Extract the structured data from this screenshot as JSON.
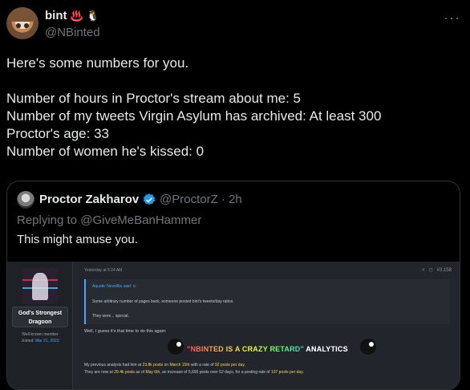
{
  "author": {
    "display_name": "bint",
    "emoji_1": "♨️",
    "emoji_2": "🐧",
    "handle": "@NBinted",
    "more_icon": "ellipsis-icon"
  },
  "tweet": {
    "lines": [
      "Here's some numbers for you.",
      "",
      "Number of hours in Proctor's stream about me: 5",
      "Number of my tweets Virgin Asylum has archived: At least 300",
      "Proctor's age: 33",
      "Number of women he's kissed: 0"
    ]
  },
  "quoted": {
    "display_name": "Proctor Zakharov",
    "handle_time": "@ProctorZ · 2h",
    "verified_color": "#1d9bf0",
    "replying_prefix": "Replying to",
    "replying_to": "@GiveMeBanHammer",
    "text": "This might amuse you.",
    "forum": {
      "username": "God's Strongest Dragoon",
      "member_title": "Well-known member",
      "joined_label": "Joined:",
      "joined_date": "Mar 21, 2023",
      "time": "Yesterday at 5:24 AM",
      "post_number": "#3,158",
      "quote_author": "Aquatic Novellite said: ⊙",
      "quote_p1": "Some arbitrary number of pages back, someone posted bint's tweets/day ratios.",
      "quote_p2": "They were... special.",
      "line1": "Well, I guess it's that time to do this again:",
      "banner_main": "\"NBINTED IS A CRAZY RETARD\"",
      "banner_rest": " ANALYTICS",
      "line2_a": "My previous analysis had him at ",
      "line2_b": "23.8k posts",
      "line2_c": " on ",
      "line2_d": "March 15th",
      "line2_e": " with a rate of ",
      "line2_f": "92 posts per day",
      "line2_g": ".",
      "line3_a": "They are now at ",
      "line3_b": "29.4k posts",
      "line3_c": " as of ",
      "line3_d": "May 6th",
      "line3_e": ", an increase of 5,600 posts over 52 days, for a posting rate of ",
      "line3_f": "107 posts per day",
      "line3_g": "."
    }
  }
}
